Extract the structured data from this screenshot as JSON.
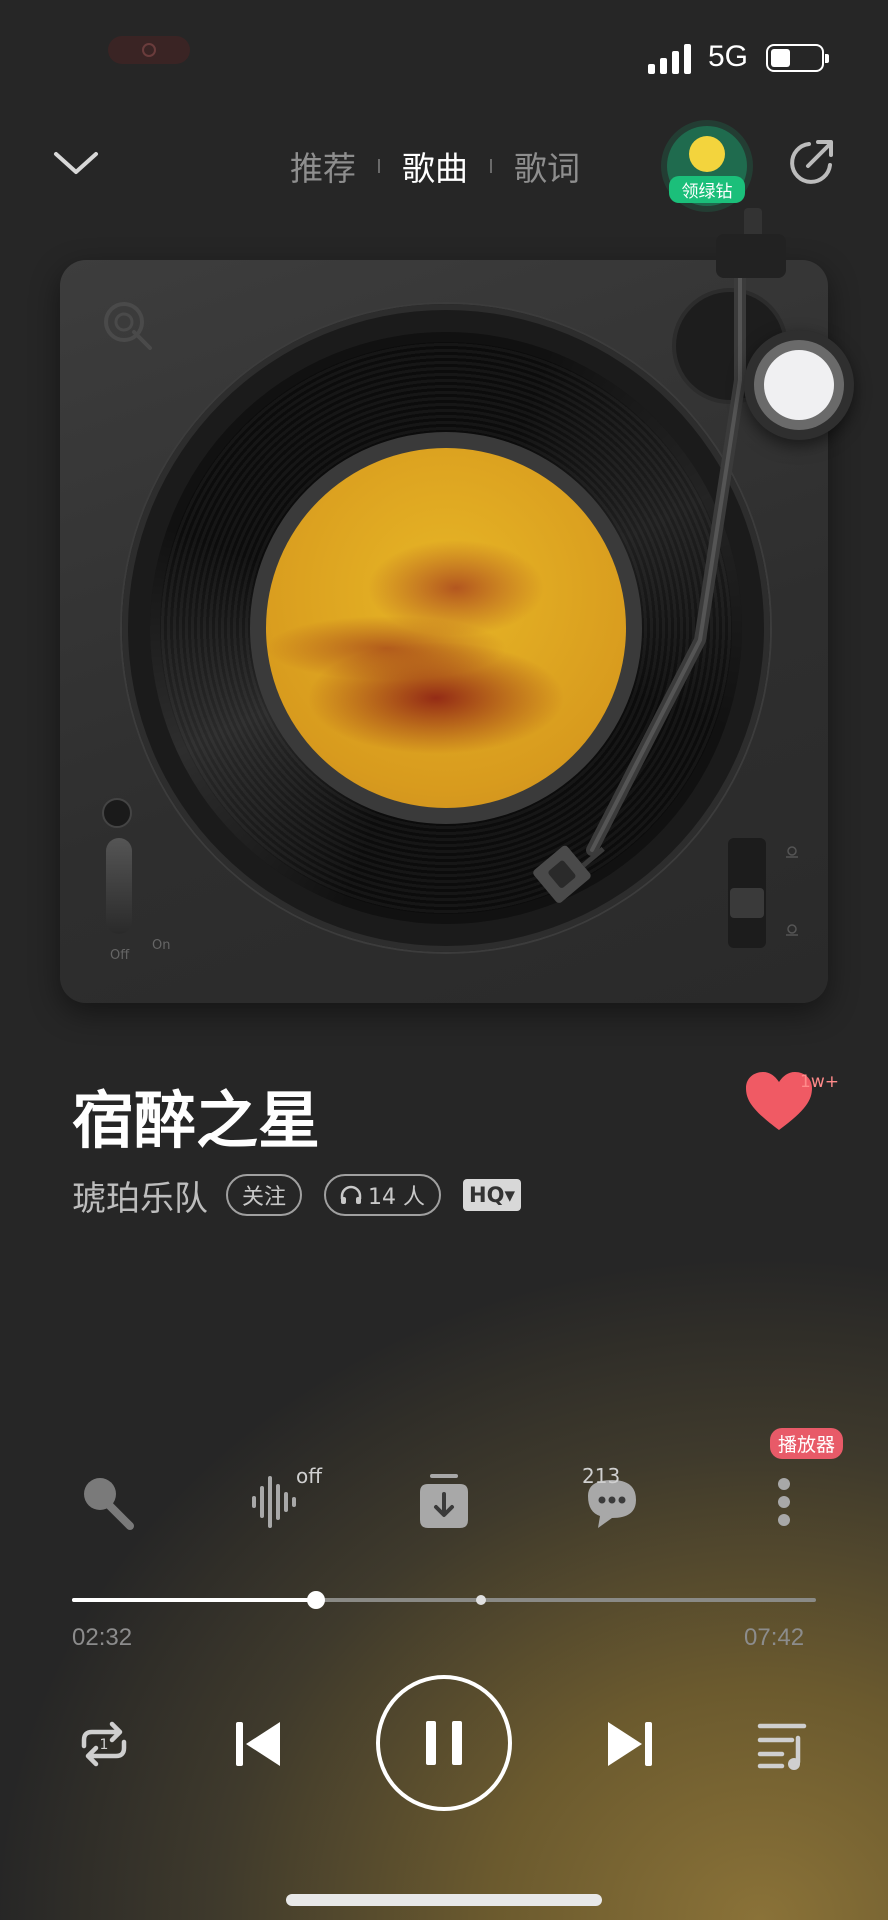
{
  "status_bar": {
    "network": "5G",
    "battery_percent": 40
  },
  "header": {
    "tabs": [
      {
        "label": "推荐",
        "active": false
      },
      {
        "label": "歌曲",
        "active": true
      },
      {
        "label": "歌词",
        "active": false
      }
    ],
    "badge_label": "领绿钻"
  },
  "turntable": {
    "switch_off_label": "Off",
    "switch_on_label": "On"
  },
  "song": {
    "title": "宿醉之星",
    "artist": "琥珀乐队",
    "follow_label": "关注",
    "listeners_label": "14 人",
    "quality_label": "HQ▾",
    "like_count": "1w+"
  },
  "actions": {
    "effect_state": "off",
    "comment_count": "213",
    "player_tag": "播放器"
  },
  "playback": {
    "current_time": "02:32",
    "total_time": "07:42",
    "progress_fraction": 0.328,
    "buffer_fraction": 0.55
  },
  "colors": {
    "accent_green": "#1bbf7a",
    "like_red": "#f05a64",
    "player_tag": "#e85a68"
  },
  "icons": [
    "chevron-down-icon",
    "share-icon",
    "mic-icon",
    "sound-effect-icon",
    "download-icon",
    "comment-icon",
    "more-icon",
    "repeat-icon",
    "previous-icon",
    "pause-icon",
    "next-icon",
    "playlist-icon",
    "heart-icon",
    "headphones-icon"
  ]
}
